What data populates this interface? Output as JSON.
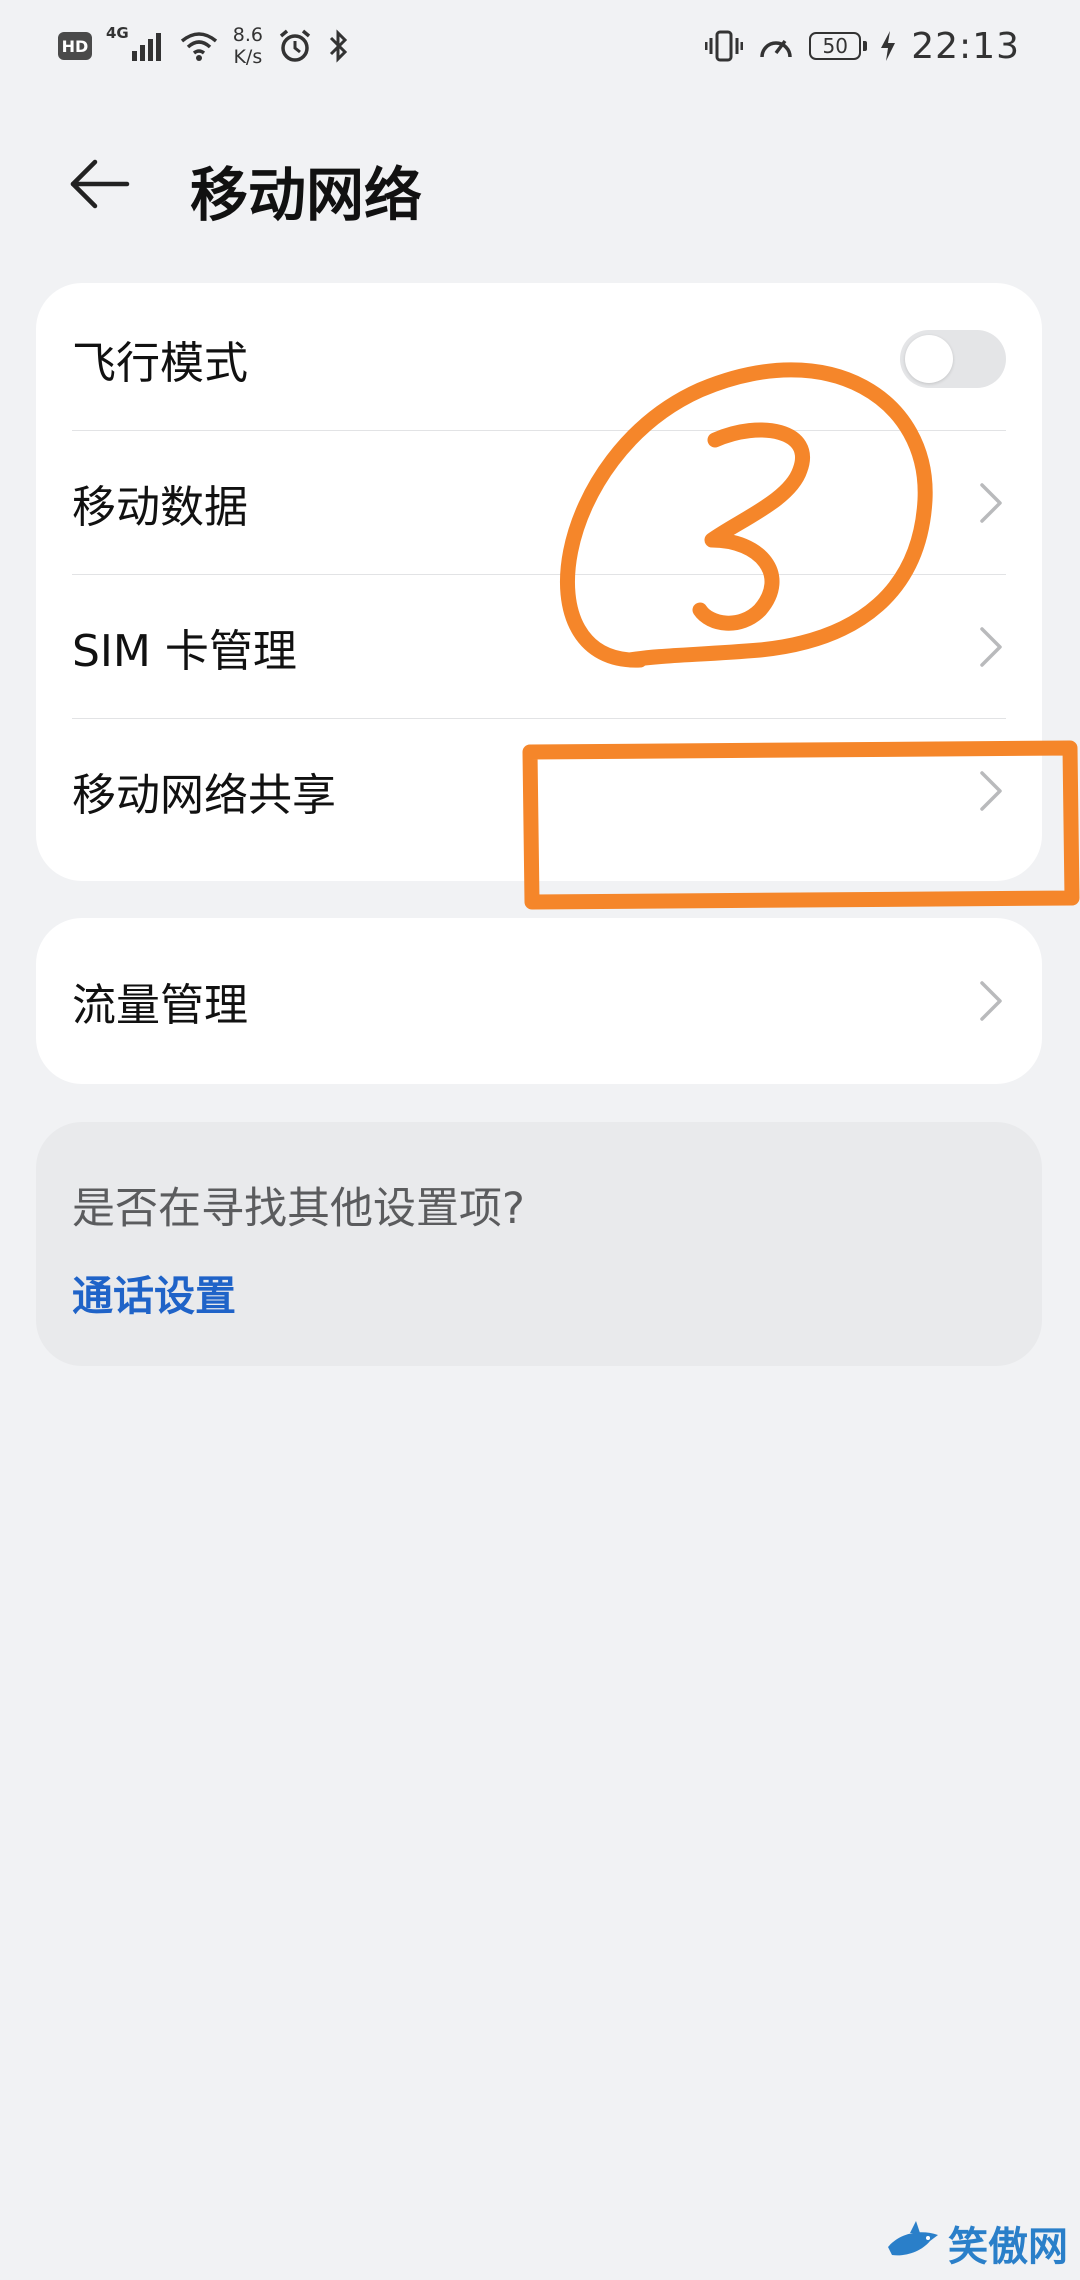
{
  "status_bar": {
    "hd": "HD",
    "network": "4G",
    "speed_value": "8.6",
    "speed_unit": "K/s",
    "battery": "50",
    "time": "22:13",
    "icons": [
      "signal-icon",
      "wifi-icon",
      "alarm-icon",
      "bluetooth-icon",
      "vibrate-icon",
      "speedometer-icon",
      "battery-icon",
      "charging-icon"
    ]
  },
  "header": {
    "title": "移动网络",
    "back_icon": "back-arrow-icon"
  },
  "main_card": {
    "items": [
      {
        "label": "飞行模式",
        "control": "toggle",
        "on": false
      },
      {
        "label": "移动数据",
        "control": "chevron"
      },
      {
        "label": "SIM 卡管理",
        "control": "chevron"
      },
      {
        "label": "移动网络共享",
        "control": "chevron"
      }
    ]
  },
  "traffic_card": {
    "label": "流量管理"
  },
  "hint_card": {
    "title": "是否在寻找其他设置项?",
    "link": "通话设置"
  },
  "annotations": {
    "circled_number": "3",
    "color": "#f5862a"
  },
  "watermark": {
    "text": "笑傲网"
  },
  "colors": {
    "background": "#f1f2f4",
    "card": "#ffffff",
    "link": "#1f63c8",
    "annotation": "#f5862a"
  }
}
